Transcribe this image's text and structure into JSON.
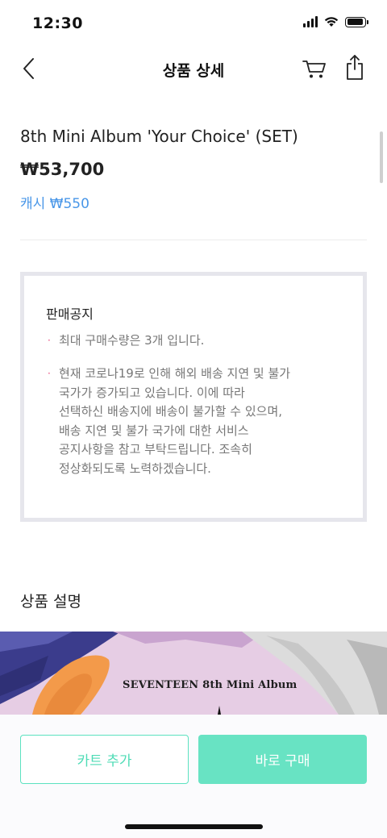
{
  "status_bar": {
    "time": "12:30"
  },
  "nav": {
    "title": "상품 상세",
    "back_icon": "chevron-left-icon",
    "cart_icon": "cart-icon",
    "share_icon": "share-icon"
  },
  "product": {
    "title": "8th Mini Album 'Your Choice' (SET)",
    "price": "₩53,700",
    "cash": "캐시 ₩550"
  },
  "notice": {
    "title": "판매공지",
    "items": [
      {
        "lines": [
          "최대 구매수량은 3개 입니다."
        ]
      },
      {
        "lines": [
          "현재 코로나19로 인해 해외 배송 지연 및 불가",
          "국가가 증가되고 있습니다. 이에 따라",
          "선택하신 배송지에 배송이 불가할 수 있으며,",
          "배송 지연 및 불가 국가에 대한 서비스",
          "공지사항을 참고 부탁드립니다. 조속히",
          "정상화되도록 노력하겠습니다."
        ]
      }
    ],
    "bullet": "·",
    "bullet_color": "#e8457a"
  },
  "description": {
    "title": "상품 설명",
    "banner_text": "SEVENTEEN 8th Mini Album"
  },
  "actions": {
    "cart_label": "카트 추가",
    "buy_label": "바로 구매"
  },
  "colors": {
    "accent": "#68e3c3",
    "cash_blue": "#4a97e8"
  }
}
